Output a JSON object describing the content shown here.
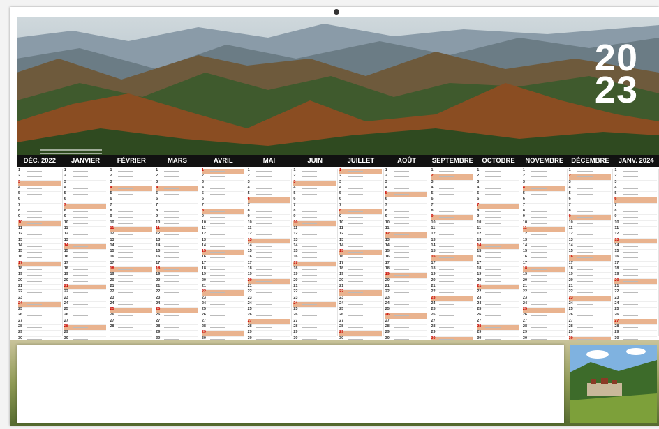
{
  "year": {
    "top": "20",
    "bottom": "23"
  },
  "months": [
    "DÉC. 2022",
    "JANVIER",
    "FÉVRIER",
    "MARS",
    "AVRIL",
    "MAI",
    "JUIN",
    "JUILLET",
    "AOÛT",
    "SEPTEMBRE",
    "OCTOBRE",
    "NOVEMBRE",
    "DÉCEMBRE",
    "JANV. 2024"
  ],
  "days_in_month": [
    31,
    31,
    28,
    31,
    30,
    31,
    30,
    31,
    31,
    30,
    31,
    30,
    31,
    31
  ],
  "colors": {
    "weekend": "#e9b38f",
    "month_bar": "#111111",
    "holiday_text": "#cc0000"
  },
  "images": {
    "top": "mountain-landscape-photo",
    "bottom_right": "village-vineyard-photo"
  }
}
